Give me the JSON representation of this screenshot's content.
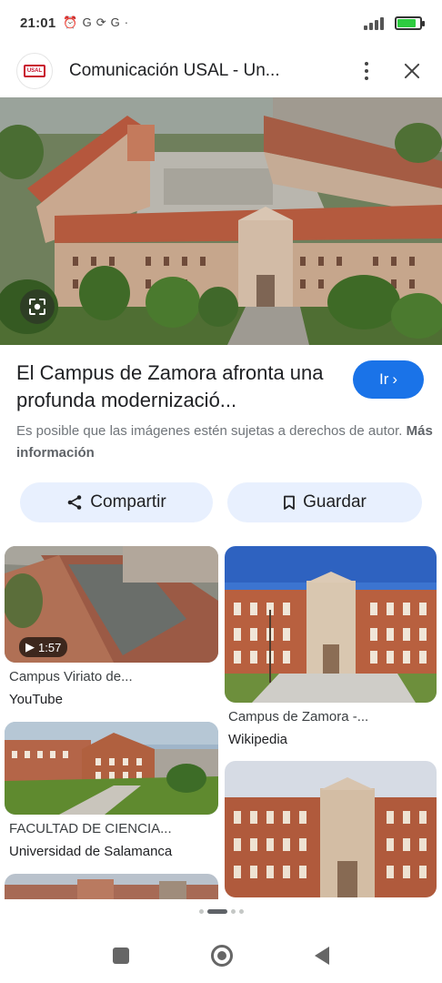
{
  "status_bar": {
    "time": "21:01",
    "left_icons": [
      "alarm-icon",
      "g-icon",
      "sync-icon",
      "g-icon",
      "dot-icon"
    ],
    "battery_level": 0.85
  },
  "header": {
    "title": "Comunicación USAL - Un...",
    "logo_icon": "usal-logo-icon"
  },
  "result": {
    "title": "El Campus de Zamora afronta una profunda modernizació...",
    "go_label": "Ir",
    "copyright_text": "Es posible que las imágenes estén sujetas a derechos de autor.",
    "more_info_label": "Más información"
  },
  "actions": {
    "share_label": "Compartir",
    "save_label": "Guardar"
  },
  "related": [
    {
      "title": "Campus Viriato de...",
      "source": "YouTube",
      "duration": "1:57"
    },
    {
      "title": "Campus de Zamora -...",
      "source": "Wikipedia"
    },
    {
      "title": "FACULTAD DE CIENCIA...",
      "source": "Universidad de Salamanca"
    },
    {
      "title": "",
      "source": ""
    }
  ],
  "colors": {
    "accent": "#1a73e8",
    "chip_bg": "#e8f0fe"
  }
}
